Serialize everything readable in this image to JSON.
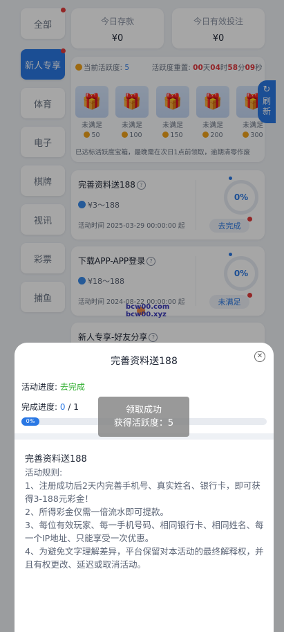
{
  "sidebar": {
    "items": [
      {
        "label": "全部"
      },
      {
        "label": "新人专享"
      },
      {
        "label": "体育"
      },
      {
        "label": "电子"
      },
      {
        "label": "棋牌"
      },
      {
        "label": "视讯"
      },
      {
        "label": "彩票"
      },
      {
        "label": "捕鱼"
      }
    ]
  },
  "stats": {
    "deposit_title": "今日存款",
    "deposit_value": "¥0",
    "bet_title": "今日有效投注",
    "bet_value": "¥0"
  },
  "treasure": {
    "active_label": "当前活跃度:",
    "active_value": "5",
    "reset_label": "活跃度重置:",
    "d": "00",
    "d_unit": "天",
    "h": "04",
    "h_unit": "时",
    "m": "58",
    "m_unit": "分",
    "s": "09",
    "s_unit": "秒",
    "boxes": [
      {
        "status": "未满足",
        "points": "50"
      },
      {
        "status": "未满足",
        "points": "100"
      },
      {
        "status": "未满足",
        "points": "150"
      },
      {
        "status": "未满足",
        "points": "200"
      },
      {
        "status": "未满足",
        "points": "300"
      }
    ],
    "note": "已达标活跃度宝箱，最晚需在次日1点前领取，逾期清零作废",
    "refresh_label_1": "刷",
    "refresh_label_2": "新"
  },
  "activities": [
    {
      "title": "完善资料送188",
      "amount": "¥3～188",
      "time": "活动时间 2025-03-29 00:00:00 起",
      "percent": "0%",
      "status": "去完成"
    },
    {
      "title": "下载APP-APP登录",
      "amount": "¥18～188",
      "time": "活动时间 2024-08-22 00:00:00 起",
      "percent": "0%",
      "status": "未满足"
    },
    {
      "title": "新人专享-好友分享"
    }
  ],
  "watermark": {
    "line1": "bcw00.com",
    "line2": "bcw00.xyz"
  },
  "sheet": {
    "title": "完善资料送188",
    "progress_label": "活动进度:",
    "progress_status": "去完成",
    "complete_label": "完成进度:",
    "complete_current": "0",
    "complete_sep": " / ",
    "complete_total": "1",
    "bar_text": "0%",
    "bar_fraction": 0,
    "rules_title": "完善资料送188",
    "rules_sub": "活动规则:",
    "rules": [
      "1、注册成功后2天内完善手机号、真实姓名、银行卡，即可获得3-188元彩金！",
      "2、所得彩金仅需一倍流水即可提款。",
      "3、每位有效玩家、每一手机号码、相同银行卡、相同姓名、每一个IP地址、只能享受一次优惠。",
      "4、为避免文字理解差异，平台保留对本活动的最终解释权，并且有权更改、延迟或取消活动。"
    ]
  },
  "toast": {
    "line1": "领取成功",
    "line2": "获得活跃度：5"
  },
  "colors": {
    "accent": "#2a78e4",
    "success": "#2fae2e",
    "alert": "#e0383e",
    "coin": "#f0a21b"
  }
}
